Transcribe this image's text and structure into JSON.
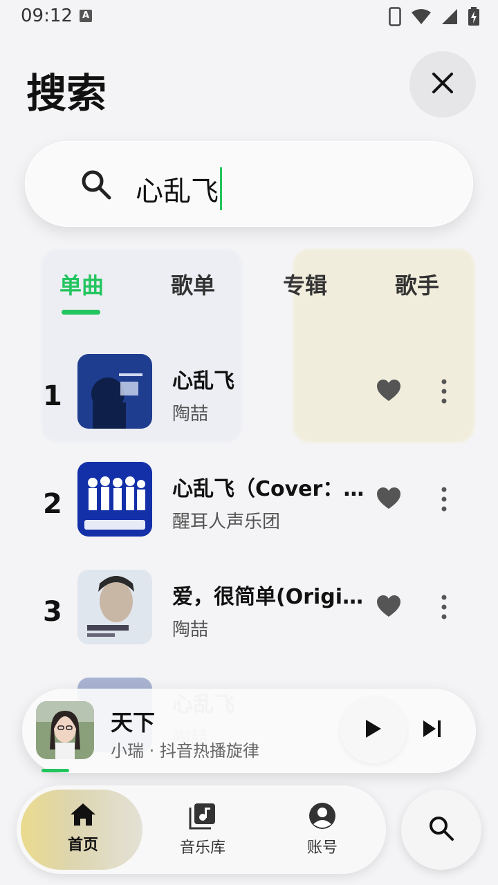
{
  "status_bar": {
    "time": "09:12",
    "indicator": "A",
    "icons": [
      "phone-icon",
      "wifi-icon",
      "signal-icon",
      "battery-charging-icon"
    ]
  },
  "header": {
    "title": "搜索",
    "close_icon": "close-icon"
  },
  "search": {
    "value": "心乱飞",
    "icon": "search-icon"
  },
  "tabs": [
    {
      "label": "单曲",
      "active": true
    },
    {
      "label": "歌单",
      "active": false
    },
    {
      "label": "专辑",
      "active": false
    },
    {
      "label": "歌手",
      "active": false
    }
  ],
  "songs": [
    {
      "rank": "1",
      "title": "心乱飞",
      "artist": "陶喆"
    },
    {
      "rank": "2",
      "title": "心乱飞（Cover：陶喆）",
      "artist": "醒耳人声乐团"
    },
    {
      "rank": "3",
      "title": "爱，很简单(Original)",
      "artist": "陶喆"
    }
  ],
  "now_playing": {
    "title": "天下",
    "subtitle": "小瑞 · 抖音热播旋律"
  },
  "nav": {
    "items": [
      {
        "label": "首页",
        "icon": "home-icon",
        "active": true
      },
      {
        "label": "音乐库",
        "icon": "music-library-icon",
        "active": false
      },
      {
        "label": "账号",
        "icon": "account-icon",
        "active": false
      }
    ]
  },
  "colors": {
    "accent": "#22c55e",
    "background": "#f4f4f6"
  }
}
